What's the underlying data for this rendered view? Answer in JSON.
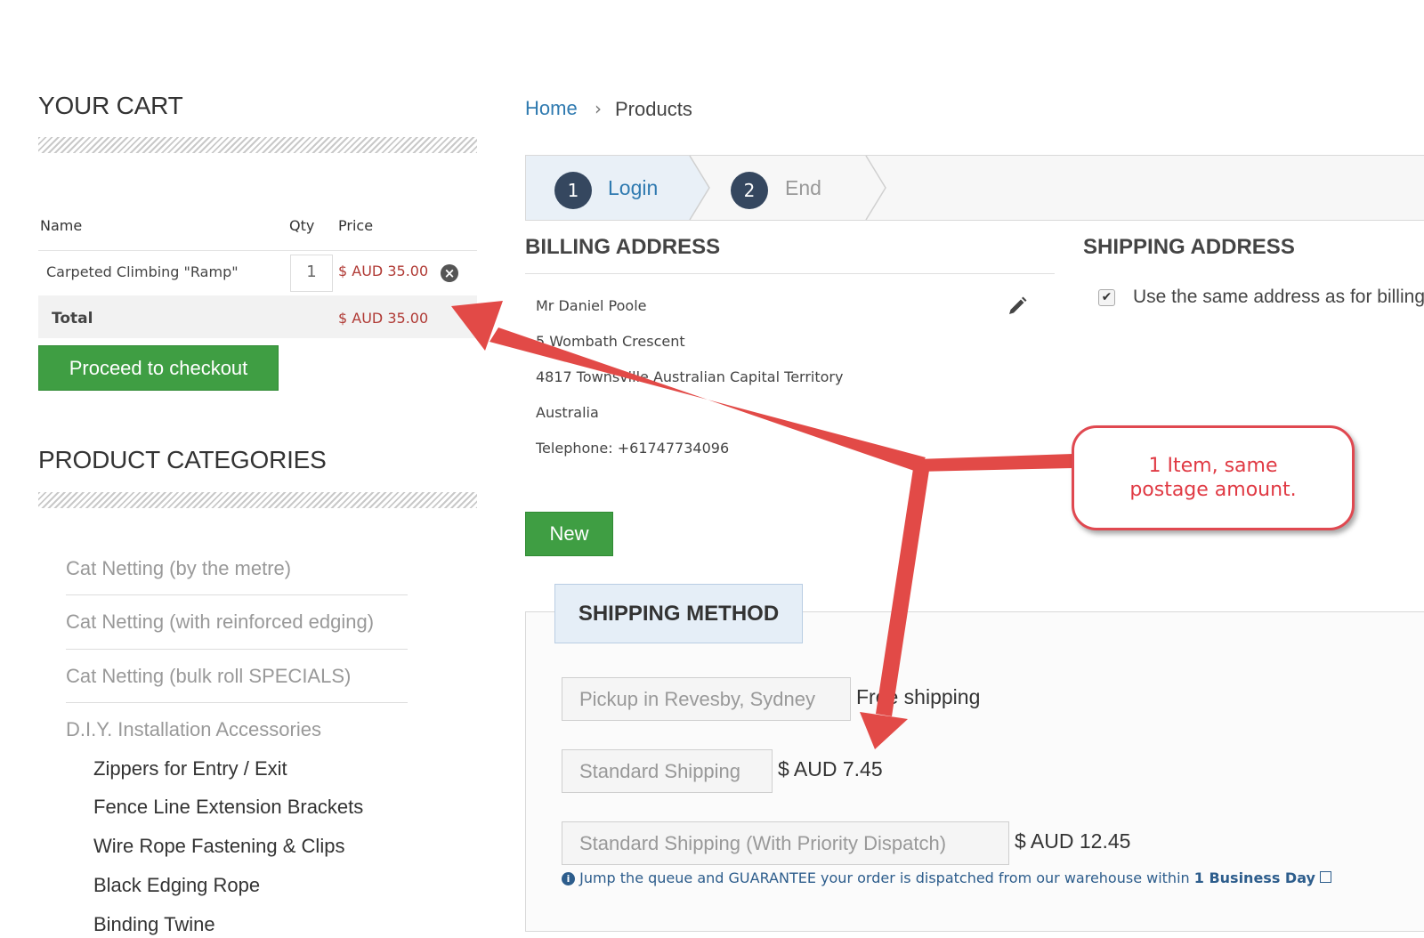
{
  "cart": {
    "title": "YOUR CART",
    "headers": {
      "name": "Name",
      "qty": "Qty",
      "price": "Price"
    },
    "item": {
      "name": "Carpeted Climbing \"Ramp\"",
      "qty": "1",
      "price": "$ AUD 35.00"
    },
    "total_label": "Total",
    "total_value": "$ AUD 35.00",
    "checkout_label": "Proceed to checkout"
  },
  "categories": {
    "title": "PRODUCT CATEGORIES",
    "items": [
      "Cat Netting (by the metre)",
      "Cat Netting (with reinforced edging)",
      "Cat Netting (bulk roll SPECIALS)",
      "D.I.Y. Installation Accessories"
    ],
    "subitems": [
      "Zippers for Entry / Exit",
      "Fence Line Extension Brackets",
      "Wire Rope Fastening & Clips",
      "Black Edging Rope",
      "Binding Twine"
    ]
  },
  "breadcrumb": {
    "home": "Home",
    "separator": "›",
    "current": "Products"
  },
  "steps": [
    {
      "num": "1",
      "label": "Login"
    },
    {
      "num": "2",
      "label": "End"
    }
  ],
  "billing": {
    "title": "BILLING ADDRESS",
    "lines": [
      "Mr Daniel Poole",
      "5 Wombath Crescent",
      "4817 Townsville Australian Capital Territory",
      "Australia",
      "Telephone: +61747734096"
    ],
    "new_label": "New"
  },
  "shipping_address": {
    "title": "SHIPPING ADDRESS",
    "same_label": "Use the same address as for billing",
    "same_checked": true
  },
  "shipping_method": {
    "title": "SHIPPING METHOD",
    "options": [
      {
        "label": "Pickup in Revesby, Sydney",
        "price": "Free shipping"
      },
      {
        "label": "Standard Shipping",
        "price": "$ AUD 7.45"
      },
      {
        "label": "Standard Shipping (With Priority Dispatch)",
        "price": "$ AUD 12.45"
      }
    ],
    "note_prefix": "Jump the queue and GUARANTEE your order is dispatched from our warehouse within",
    "note_bold": "1 Business Day"
  },
  "annotation": {
    "text": "1 Item, same postage amount."
  },
  "colors": {
    "accent_green": "#3f9e43",
    "price_red": "#b03a35",
    "link_blue": "#2f7ab0",
    "callout_red": "#e04850"
  }
}
